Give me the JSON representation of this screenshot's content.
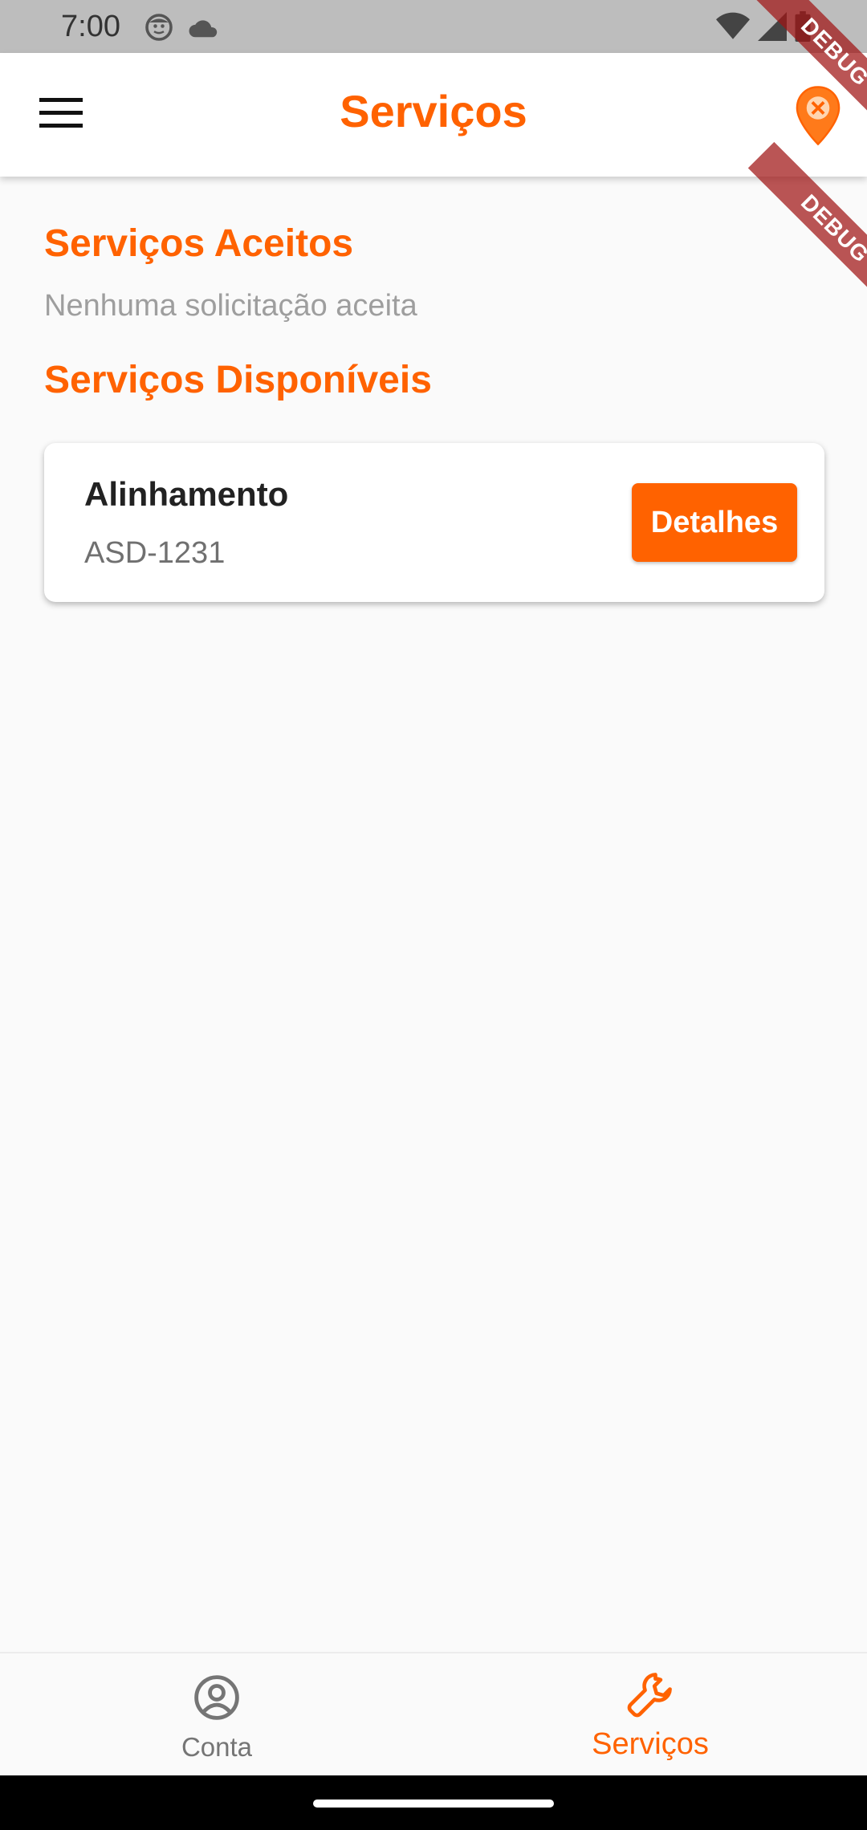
{
  "status_bar": {
    "time": "7:00",
    "left_icons": [
      "android-face-icon",
      "cloud-icon"
    ],
    "right_icons": [
      "wifi-icon",
      "signal-icon",
      "battery-icon"
    ]
  },
  "app_bar": {
    "title": "Serviços",
    "menu_icon": "hamburger-menu-icon",
    "location_icon": "location-pin-icon"
  },
  "debug_banner": {
    "label": "DEBUG"
  },
  "accepted_section": {
    "title": "Serviços Aceitos",
    "empty_message": "Nenhuma solicitação aceita"
  },
  "available_section": {
    "title": "Serviços Disponíveis",
    "items": [
      {
        "title": "Alinhamento",
        "subtitle": "ASD-1231",
        "button_label": "Detalhes"
      }
    ]
  },
  "bottom_nav": {
    "items": [
      {
        "label": "Conta",
        "icon": "account-circle-icon",
        "active": false
      },
      {
        "label": "Serviços",
        "icon": "wrench-icon",
        "active": true
      }
    ]
  },
  "colors": {
    "accent": "#ff6200",
    "status_bar": "#bdbdbd",
    "background": "#fafafa",
    "inactive": "#757575"
  }
}
